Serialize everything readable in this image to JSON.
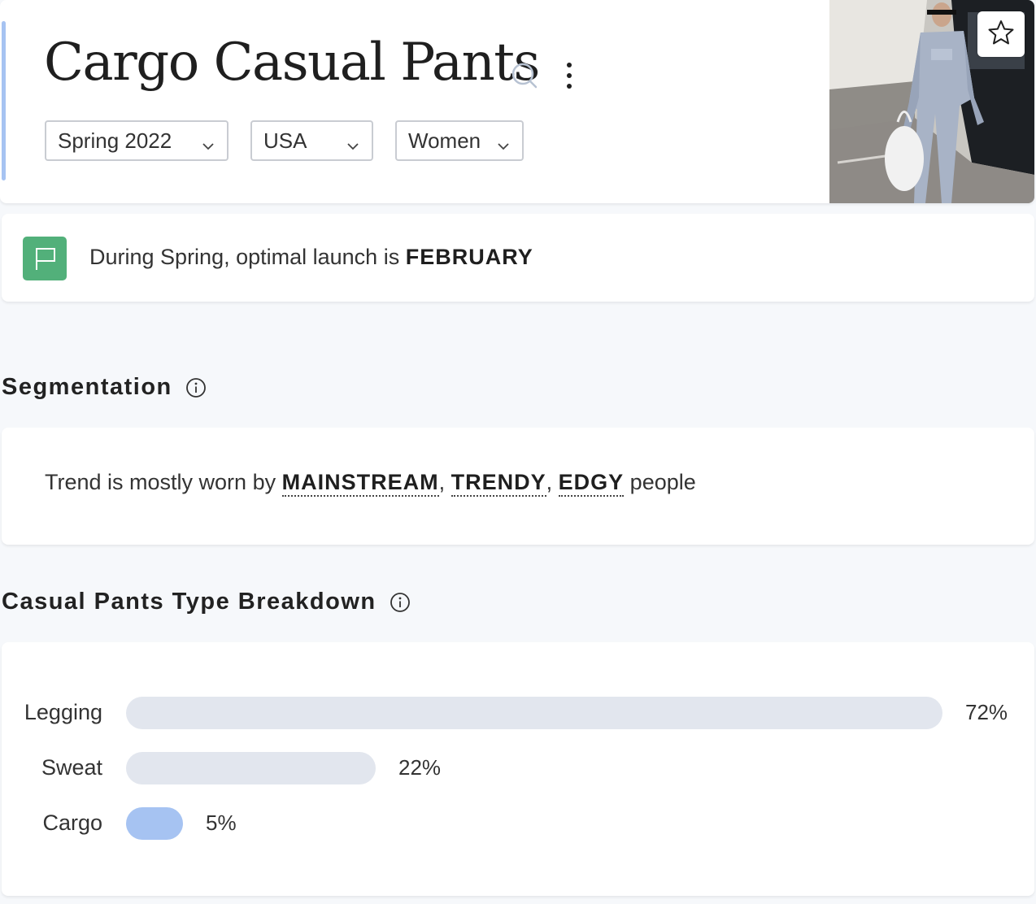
{
  "header": {
    "title": "Cargo Casual Pants",
    "filters": {
      "season": "Spring 2022",
      "country": "USA",
      "gender": "Women"
    }
  },
  "launch": {
    "prefix": "During Spring, optimal launch is ",
    "month": "FEBRUARY"
  },
  "segmentation": {
    "title": "Segmentation",
    "prefix": "Trend is mostly worn by ",
    "segments": [
      "MAINSTREAM",
      "TRENDY",
      "EDGY"
    ],
    "separator": ", ",
    "suffix": " people"
  },
  "breakdown": {
    "title": "Casual Pants Type Breakdown",
    "rows": [
      {
        "label": "Legging",
        "value": 72,
        "display": "72%",
        "highlight": false
      },
      {
        "label": "Sweat",
        "value": 22,
        "display": "22%",
        "highlight": false
      },
      {
        "label": "Cargo",
        "value": 5,
        "display": "5%",
        "highlight": true
      }
    ]
  },
  "colors": {
    "accent": "#a6c3f2",
    "bar": "#e2e6ee",
    "flag": "#52b07a"
  },
  "icons": [
    "search-icon",
    "more-vertical-icon",
    "chevron-down-icon",
    "star-icon",
    "flag-icon",
    "info-icon"
  ]
}
